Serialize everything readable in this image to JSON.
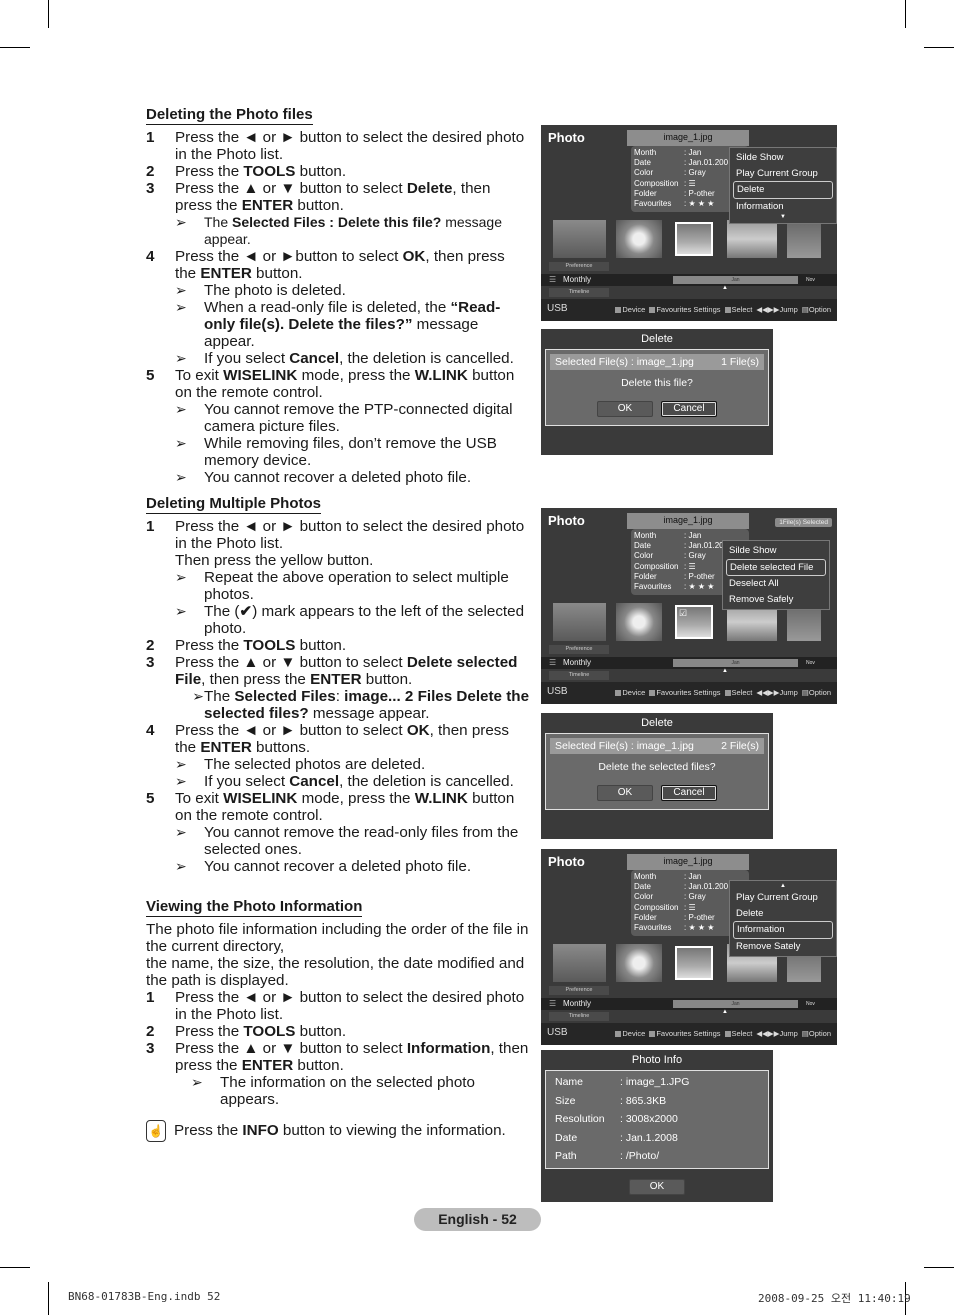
{
  "sections": {
    "delete_files": {
      "title": "Deleting the Photo files",
      "s1_num": "1",
      "s1": "Press the ◄ or ► button to select the desired photo in the Photo list.",
      "s2_num": "2",
      "s2_pre": "Press the ",
      "s2_b": "TOOLS",
      "s2_post": " button.",
      "s3_num": "3",
      "s3_pre": "Press the ▲ or ▼ button to select ",
      "s3_b": "Delete",
      "s3_mid": ", then press the ",
      "s3_b2": "ENTER",
      "s3_post": " button.",
      "n3_pre": "The ",
      "n3_b": "Selected Files : Delete this file?",
      "n3_post": " message appear.",
      "s4_num": "4",
      "s4_pre": "Press the ◄ or ►button to select ",
      "s4_b": "OK",
      "s4_mid": ", then press the ",
      "s4_b2": "ENTER",
      "s4_post": " button.",
      "n4a": "The photo is deleted.",
      "n4b_pre": "When a read-only file is deleted, the ",
      "n4b_b": "“Read-only file(s). Delete the files?”",
      "n4b_post": " message appear.",
      "n4c_pre": "If you select ",
      "n4c_b": "Cancel",
      "n4c_post": ", the deletion is cancelled.",
      "s5_num": "5",
      "s5_pre": "To exit ",
      "s5_b": "WISELINK",
      "s5_mid": " mode, press the ",
      "s5_b2": "W.LINK",
      "s5_post": " button on the remote control.",
      "n5a": "You cannot remove the PTP-connected digital camera picture files.",
      "n5b": "While removing files, don’t remove the USB memory device.",
      "n5c": "You cannot recover a deleted photo file."
    },
    "delete_multiple": {
      "title": "Deleting Multiple Photos",
      "s1_num": "1",
      "s1": "Press the ◄ or ► button to select the desired photo in the Photo list.",
      "s1b": "Then press the yellow button.",
      "n1a": "Repeat the above operation to select multiple photos.",
      "n1b_pre": "The (",
      "n1b_mark": "✔",
      "n1b_post": ") mark appears to the left of the selected photo.",
      "s2_num": "2",
      "s2_pre": "Press the ",
      "s2_b": "TOOLS",
      "s2_post": " button.",
      "s3_num": "3",
      "s3_pre": "Press the ▲ or ▼ button to select ",
      "s3_b": "Delete selected File",
      "s3_mid": ", then press the ",
      "s3_b2": "ENTER",
      "s3_post": " button.",
      "n3_pre": "The ",
      "n3_b": "Selected Files",
      "n3_mid": ": ",
      "n3_b2": "image... 2 Files Delete the selected files?",
      "n3_post": "  message appear.",
      "s4_num": "4",
      "s4_pre": "Press the ◄ or ► button to select ",
      "s4_b": "OK",
      "s4_mid": ", then press the ",
      "s4_b2": "ENTER",
      "s4_post": " buttons.",
      "n4a": "The selected photos are deleted.",
      "n4b_pre": "If you select ",
      "n4b_b": "Cancel",
      "n4b_post": ", the deletion is cancelled.",
      "s5_num": "5",
      "s5_pre": "To exit ",
      "s5_b": "WISELINK",
      "s5_mid": " mode, press the ",
      "s5_b2": "W.LINK",
      "s5_post": " button on the remote control.",
      "n5a": "You cannot remove the read-only files from the selected ones.",
      "n5b": "You cannot recover a deleted photo file."
    },
    "view_info": {
      "title": "Viewing the Photo Information",
      "intro1": "The photo file information including the order of the file in the current directory,",
      "intro2": "the name, the size, the resolution, the date modified and the path is displayed.",
      "s1_num": "1",
      "s1": "Press the ◄ or ► button to select the desired photo in the Photo list.",
      "s2_num": "2",
      "s2_pre": "Press the ",
      "s2_b": "TOOLS",
      "s2_post": " button.",
      "s3_num": "3",
      "s3_pre": "Press the ▲ or ▼ button to select ",
      "s3_b": "Information",
      "s3_mid": ", then press the ",
      "s3_b2": "ENTER",
      "s3_post": " button.",
      "n3": "The information on the selected photo appears.",
      "tip_pre": "Press the ",
      "tip_b": "INFO",
      "tip_post": " button to viewing the information."
    }
  },
  "arrow_glyph": "➢",
  "tv": {
    "title": "Photo",
    "filename": "image_1.jpg",
    "meta": [
      {
        "k": "Month",
        "v": ": Jan"
      },
      {
        "k": "Date",
        "v": ": Jan.01.200"
      },
      {
        "k": "Color",
        "v": ": Gray"
      },
      {
        "k": "Composition",
        "v": ": ☰"
      },
      {
        "k": "Folder",
        "v": ": P-other"
      },
      {
        "k": "Favourites",
        "v": ": ★ ★ ★"
      }
    ],
    "preference": "Preference",
    "monthly": "Monthly",
    "timeline": "Timeline",
    "jan": "Jan",
    "nov": "Nov",
    "source": "USB",
    "legend": {
      "device": "Device",
      "fav": "Favourites Settings",
      "select": "Select",
      "jump": "Jump",
      "option": "Option"
    },
    "selected_badge": "1File(s) Selected",
    "check": "☑",
    "menu1": [
      "Silde Show",
      "Play Current Group",
      "Delete",
      "Information"
    ],
    "menu2": [
      "Silde Show",
      "Delete selected File",
      "Deselect All",
      "Remove Safely"
    ],
    "menu3": [
      "Play Current Group",
      "Delete",
      "Information",
      "Remove Sately"
    ]
  },
  "dialog1": {
    "title": "Delete",
    "selected": "Selected File(s) : image_1.jpg",
    "count": "1 File(s)",
    "question": "Delete this file?",
    "ok": "OK",
    "cancel": "Cancel"
  },
  "dialog2": {
    "title": "Delete",
    "selected": "Selected File(s) : image_1.jpg",
    "count": "2 File(s)",
    "question": "Delete the selected files?",
    "ok": "OK",
    "cancel": "Cancel"
  },
  "info_dialog": {
    "title": "Photo Info",
    "rows": [
      {
        "k": "Name",
        "v": ": image_1.JPG"
      },
      {
        "k": "Size",
        "v": ": 865.3KB"
      },
      {
        "k": "Resolution",
        "v": ": 3008x2000"
      },
      {
        "k": "Date",
        "v": ": Jan.1.2008"
      },
      {
        "k": "Path",
        "v": ": /Photo/"
      }
    ],
    "ok": "OK"
  },
  "footer": {
    "page_label": "English - 52",
    "print_left": "BN68-01783B-Eng.indb   52",
    "print_right": "2008-09-25   오전 11:40:19"
  }
}
